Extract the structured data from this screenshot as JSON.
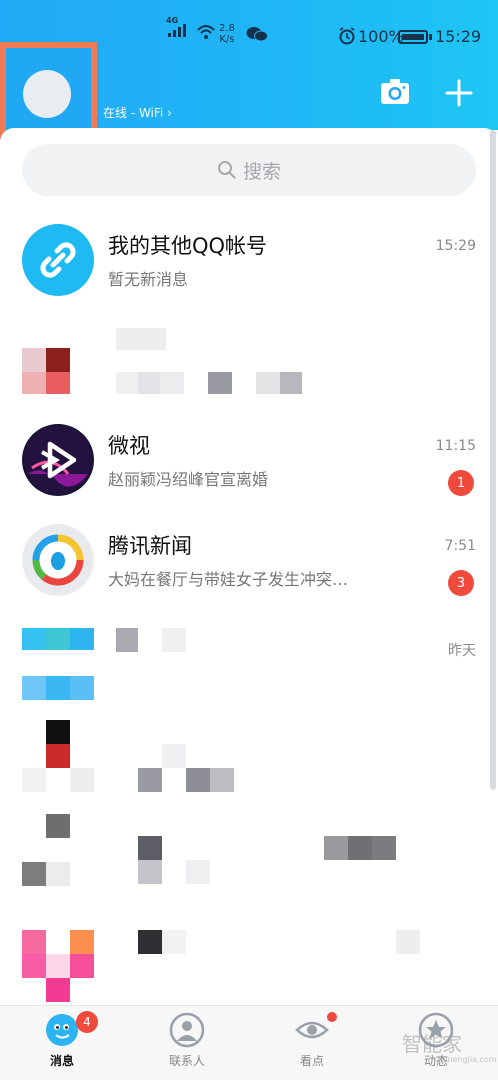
{
  "status_bar": {
    "network_tag": "4G",
    "speed": "2.8\nK/s",
    "battery_percent": "100%",
    "time": "15:29"
  },
  "header": {
    "online_status": "在线 - WiFi ›"
  },
  "search": {
    "placeholder": "搜索"
  },
  "conversations": [
    {
      "title": "我的其他QQ帐号",
      "preview": "暂无新消息",
      "time": "15:29",
      "badge": ""
    },
    {
      "title": "",
      "preview": "",
      "time": "",
      "badge": ""
    },
    {
      "title": "微视",
      "preview": "赵丽颖冯绍峰官宣离婚",
      "time": "11:15",
      "badge": "1"
    },
    {
      "title": "腾讯新闻",
      "preview": "大妈在餐厅与带娃女子发生冲突…",
      "time": "7:51",
      "badge": "3"
    },
    {
      "title": "",
      "preview": "",
      "time": "昨天",
      "badge": ""
    }
  ],
  "tabbar": {
    "items": [
      {
        "label": "消息"
      },
      {
        "label": "联系人"
      },
      {
        "label": "看点"
      },
      {
        "label": "动态"
      }
    ],
    "message_badge": "4"
  },
  "watermark": {
    "text": "智能家",
    "sub": "zhinengjia.com"
  },
  "colors": {
    "header_blue": "#1fb6f6",
    "highlight_orange": "#f07a56",
    "badge_red": "#ef4a3c"
  }
}
